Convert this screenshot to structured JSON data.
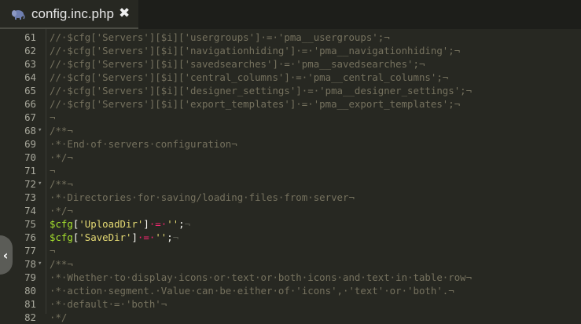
{
  "tab": {
    "title": "config.inc.php",
    "close_glyph": "✖",
    "icon": "php-elephant-icon"
  },
  "collapse_glyph": "‹",
  "colors": {
    "background": "#272822",
    "comment": "#75715e",
    "variable": "#a6e22e",
    "string": "#e6db74",
    "operator": "#f92672"
  },
  "lines": [
    {
      "num": "61",
      "fold": "",
      "type": "comment",
      "text": "//·$cfg['Servers'][$i]['usergroups']·=·'pma__usergroups';¬"
    },
    {
      "num": "62",
      "fold": "",
      "type": "comment",
      "text": "//·$cfg['Servers'][$i]['navigationhiding']·=·'pma__navigationhiding';¬"
    },
    {
      "num": "63",
      "fold": "",
      "type": "comment",
      "text": "//·$cfg['Servers'][$i]['savedsearches']·=·'pma__savedsearches';¬"
    },
    {
      "num": "64",
      "fold": "",
      "type": "comment",
      "text": "//·$cfg['Servers'][$i]['central_columns']·=·'pma__central_columns';¬"
    },
    {
      "num": "65",
      "fold": "",
      "type": "comment",
      "text": "//·$cfg['Servers'][$i]['designer_settings']·=·'pma__designer_settings';¬"
    },
    {
      "num": "66",
      "fold": "",
      "type": "comment",
      "text": "//·$cfg['Servers'][$i]['export_templates']·=·'pma__export_templates';¬"
    },
    {
      "num": "67",
      "fold": "",
      "type": "comment",
      "text": "¬"
    },
    {
      "num": "68",
      "fold": "▾",
      "type": "comment",
      "text": "/**¬"
    },
    {
      "num": "69",
      "fold": "",
      "type": "comment",
      "text": "·*·End·of·servers·configuration¬"
    },
    {
      "num": "70",
      "fold": "",
      "type": "comment",
      "text": "·*/¬"
    },
    {
      "num": "71",
      "fold": "",
      "type": "comment",
      "text": "¬"
    },
    {
      "num": "72",
      "fold": "▾",
      "type": "comment",
      "text": "/**¬"
    },
    {
      "num": "73",
      "fold": "",
      "type": "comment",
      "text": "·*·Directories·for·saving/loading·files·from·server¬"
    },
    {
      "num": "74",
      "fold": "",
      "type": "comment",
      "text": "·*/¬"
    },
    {
      "num": "75",
      "fold": "",
      "type": "code",
      "var": "$cfg",
      "bracket_open": "[",
      "key": "'UploadDir'",
      "bracket_close": "]",
      "eq": "·=·",
      "value": "''",
      "end": ";",
      "eol": "¬"
    },
    {
      "num": "76",
      "fold": "",
      "type": "code",
      "var": "$cfg",
      "bracket_open": "[",
      "key": "'SaveDir'",
      "bracket_close": "]",
      "eq": "·=·",
      "value": "''",
      "end": ";",
      "eol": "¬"
    },
    {
      "num": "77",
      "fold": "",
      "type": "comment",
      "text": "¬"
    },
    {
      "num": "78",
      "fold": "▾",
      "type": "comment",
      "text": "/**¬"
    },
    {
      "num": "79",
      "fold": "",
      "type": "comment",
      "text": "·*·Whether·to·display·icons·or·text·or·both·icons·and·text·in·table·row¬"
    },
    {
      "num": "80",
      "fold": "",
      "type": "comment",
      "text": "·*·action·segment.·Value·can·be·either·of·'icons',·'text'·or·'both'.¬"
    },
    {
      "num": "81",
      "fold": "",
      "type": "comment",
      "text": "·*·default·=·'both'¬"
    },
    {
      "num": "82",
      "fold": "",
      "type": "comment",
      "text": "·*/"
    }
  ]
}
